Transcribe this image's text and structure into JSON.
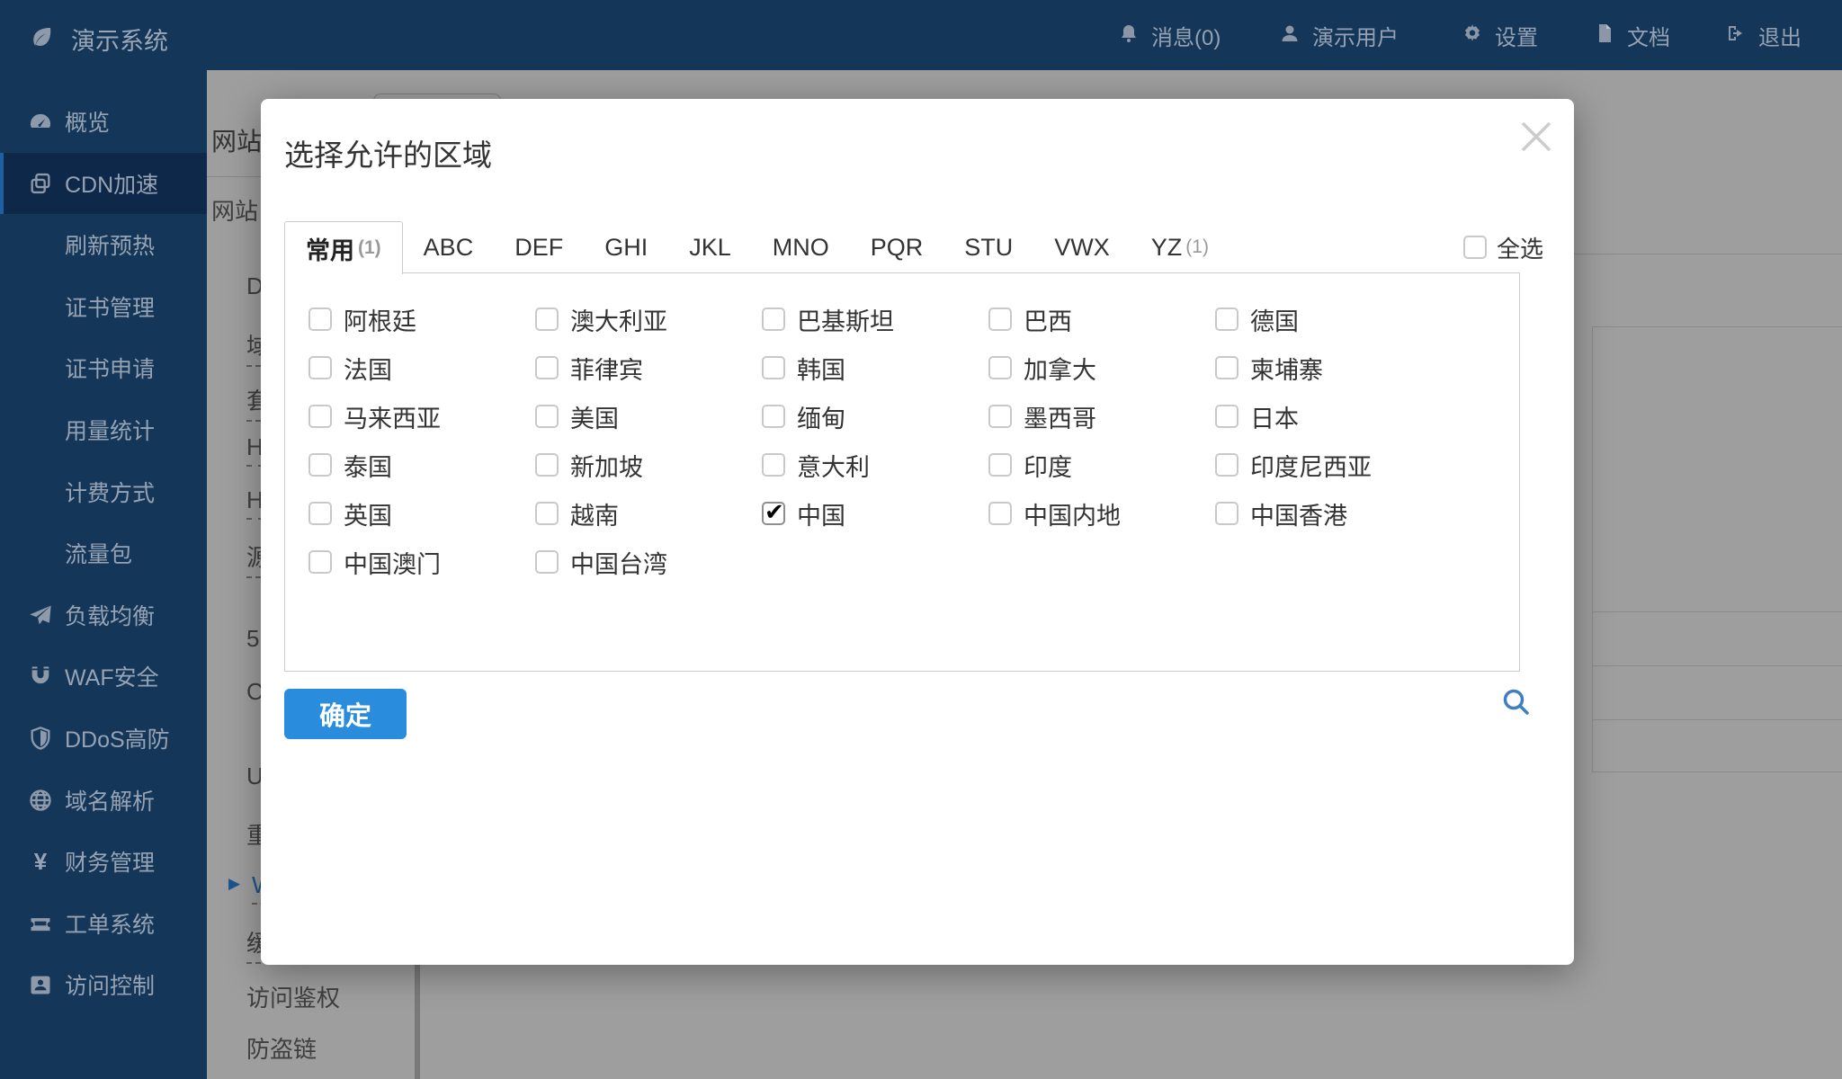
{
  "topbar": {
    "logo": {
      "icon": "leaf-icon",
      "label": "演示系统"
    },
    "items": [
      {
        "icon": "bell-icon",
        "label": "消息(0)"
      },
      {
        "icon": "user-icon",
        "label": "演示用户"
      },
      {
        "icon": "gear-icon",
        "label": "设置"
      },
      {
        "icon": "document-icon",
        "label": "文档"
      },
      {
        "icon": "logout-icon",
        "label": "退出"
      }
    ]
  },
  "sidebar": {
    "items": [
      {
        "icon": "gauge-icon",
        "label": "概览",
        "active": false
      },
      {
        "icon": "copy-icon",
        "label": "CDN加速",
        "active": true
      },
      {
        "icon": "",
        "label": "刷新预热",
        "active": false
      },
      {
        "icon": "",
        "label": "证书管理",
        "active": false
      },
      {
        "icon": "",
        "label": "证书申请",
        "active": false
      },
      {
        "icon": "",
        "label": "用量统计",
        "active": false
      },
      {
        "icon": "",
        "label": "计费方式",
        "active": false
      },
      {
        "icon": "",
        "label": "流量包",
        "active": false
      },
      {
        "icon": "plane-icon",
        "label": "负载均衡",
        "active": false
      },
      {
        "icon": "magnet-icon",
        "label": "WAF安全",
        "active": false
      },
      {
        "icon": "shield-icon",
        "label": "DDoS高防",
        "active": false
      },
      {
        "icon": "globe-icon",
        "label": "域名解析",
        "active": false
      },
      {
        "icon": "yen-icon",
        "label": "财务管理",
        "active": false
      },
      {
        "icon": "ticket-icon",
        "label": "工单系统",
        "active": false
      },
      {
        "icon": "idcard-icon",
        "label": "访问控制",
        "active": false
      }
    ]
  },
  "background": {
    "secondary_menu": {
      "header": "网站",
      "items": [
        {
          "label": "D",
          "dashed": false,
          "blue": false
        },
        {
          "label": "域",
          "dashed": true,
          "blue": false
        },
        {
          "label": "套",
          "dashed": true,
          "blue": false
        },
        {
          "label": "H",
          "dashed": true,
          "blue": false
        },
        {
          "label": "H",
          "dashed": true,
          "blue": false
        },
        {
          "label": "源",
          "dashed": true,
          "blue": false
        },
        {
          "label": "5",
          "dashed": false,
          "blue": false
        },
        {
          "label": "C",
          "dashed": false,
          "blue": false
        },
        {
          "label": "U",
          "dashed": false,
          "blue": false
        },
        {
          "label": "重",
          "dashed": false,
          "blue": false
        },
        {
          "label": "W",
          "dashed": true,
          "blue": true
        },
        {
          "label": "缓",
          "dashed": true,
          "blue": false
        },
        {
          "label": "访问鉴权",
          "dashed": false,
          "blue": false
        },
        {
          "label": "防盗链",
          "dashed": false,
          "blue": false
        }
      ]
    }
  },
  "modal": {
    "title": "选择允许的区域",
    "close_icon": "close-icon",
    "tabs": [
      {
        "label": "常用",
        "count": "(1)",
        "active": true
      },
      {
        "label": "ABC",
        "count": "",
        "active": false
      },
      {
        "label": "DEF",
        "count": "",
        "active": false
      },
      {
        "label": "GHI",
        "count": "",
        "active": false
      },
      {
        "label": "JKL",
        "count": "",
        "active": false
      },
      {
        "label": "MNO",
        "count": "",
        "active": false
      },
      {
        "label": "PQR",
        "count": "",
        "active": false
      },
      {
        "label": "STU",
        "count": "",
        "active": false
      },
      {
        "label": "VWX",
        "count": "",
        "active": false
      },
      {
        "label": "YZ",
        "count": "(1)",
        "active": false
      }
    ],
    "select_all_label": "全选",
    "select_all_checked": false,
    "regions": [
      {
        "label": "阿根廷",
        "checked": false
      },
      {
        "label": "澳大利亚",
        "checked": false
      },
      {
        "label": "巴基斯坦",
        "checked": false
      },
      {
        "label": "巴西",
        "checked": false
      },
      {
        "label": "德国",
        "checked": false
      },
      {
        "label": "法国",
        "checked": false
      },
      {
        "label": "菲律宾",
        "checked": false
      },
      {
        "label": "韩国",
        "checked": false
      },
      {
        "label": "加拿大",
        "checked": false
      },
      {
        "label": "柬埔寨",
        "checked": false
      },
      {
        "label": "马来西亚",
        "checked": false
      },
      {
        "label": "美国",
        "checked": false
      },
      {
        "label": "缅甸",
        "checked": false
      },
      {
        "label": "墨西哥",
        "checked": false
      },
      {
        "label": "日本",
        "checked": false
      },
      {
        "label": "泰国",
        "checked": false
      },
      {
        "label": "新加坡",
        "checked": false
      },
      {
        "label": "意大利",
        "checked": false
      },
      {
        "label": "印度",
        "checked": false
      },
      {
        "label": "印度尼西亚",
        "checked": false
      },
      {
        "label": "英国",
        "checked": false
      },
      {
        "label": "越南",
        "checked": false
      },
      {
        "label": "中国",
        "checked": true
      },
      {
        "label": "中国内地",
        "checked": false
      },
      {
        "label": "中国香港",
        "checked": false
      },
      {
        "label": "中国澳门",
        "checked": false
      },
      {
        "label": "中国台湾",
        "checked": false
      }
    ],
    "confirm_label": "确定",
    "search_icon": "search-icon",
    "checkmark": "✔"
  },
  "colors": {
    "navy": "#133659",
    "sidebar_active": "#0d2848",
    "accent_blue": "#2a8cdc",
    "search_blue": "#3e7fc1",
    "link_blue": "#2e8ae6"
  }
}
